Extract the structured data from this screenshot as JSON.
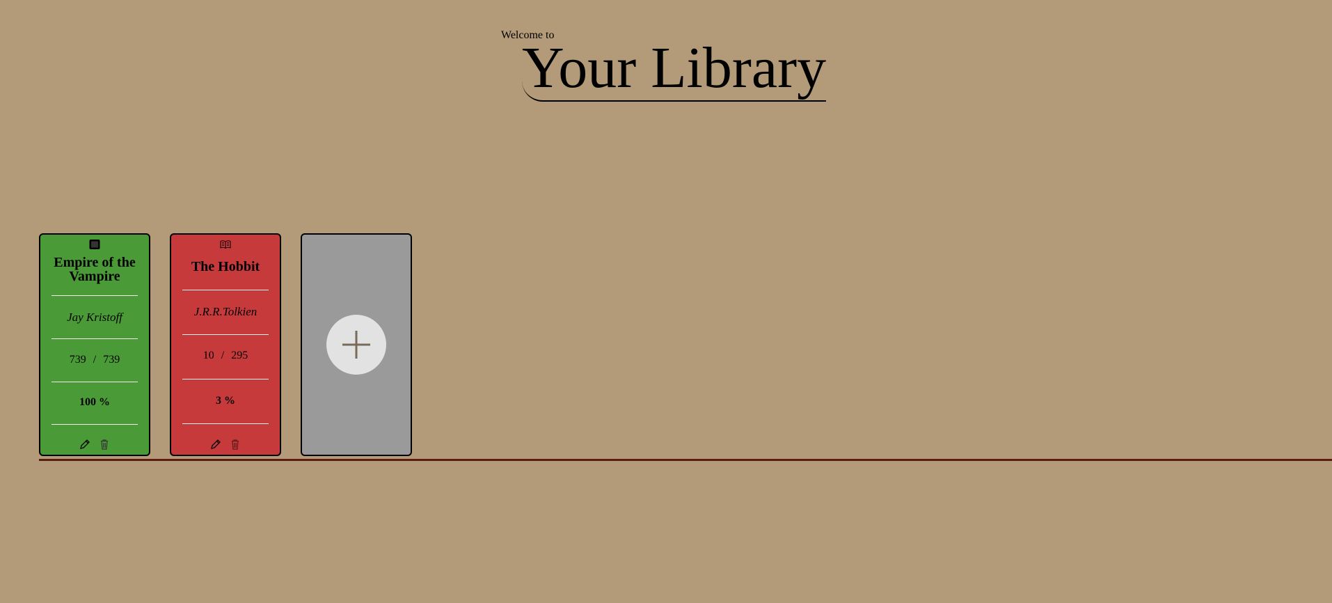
{
  "header": {
    "welcome": "Welcome to",
    "title": "Your Library"
  },
  "books": [
    {
      "title": "Empire of the Vampire",
      "author": "Jay Kristoff",
      "pages_read": "739",
      "pages_total": "739",
      "pages_separator": "/",
      "percent": "100 %",
      "status_icon": "book-closed-icon",
      "color": "#4a9a37"
    },
    {
      "title": "The Hobbit",
      "author": "J.R.R.Tolkien",
      "pages_read": "10",
      "pages_total": "295",
      "pages_separator": "/",
      "percent": "3 %",
      "status_icon": "book-open-icon",
      "color": "#c73a3b"
    }
  ],
  "add_card": {
    "icon": "plus-icon",
    "color": "#9a9a9a"
  },
  "icons": {
    "edit": "pencil-icon",
    "delete": "trash-icon"
  }
}
